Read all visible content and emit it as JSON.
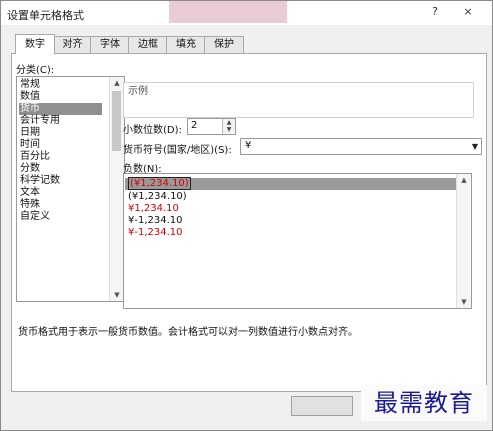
{
  "window": {
    "title": "设置单元格格式",
    "help": "?",
    "close": "×"
  },
  "tabs": [
    {
      "label": "数字"
    },
    {
      "label": "对齐"
    },
    {
      "label": "字体"
    },
    {
      "label": "边框"
    },
    {
      "label": "填充"
    },
    {
      "label": "保护"
    }
  ],
  "active_tab": "数字",
  "category": {
    "label": "分类(C):",
    "items": [
      "常规",
      "数值",
      "货币",
      "会计专用",
      "日期",
      "时间",
      "百分比",
      "分数",
      "科学记数",
      "文本",
      "特殊",
      "自定义"
    ],
    "selected": "货币"
  },
  "sample": {
    "label": "示例"
  },
  "decimal_places": {
    "label": "小数位数(D):",
    "value": "2"
  },
  "currency_symbol": {
    "label": "货币符号(国家/地区)(S):",
    "value": "¥"
  },
  "negative_numbers": {
    "label": "负数(N):",
    "items": [
      {
        "text": "(¥1,234.10)",
        "color": "#d40000"
      },
      {
        "text": "(¥1,234.10)",
        "color": "#111111"
      },
      {
        "text": "¥1,234.10",
        "color": "#d40000"
      },
      {
        "text": "¥-1,234.10",
        "color": "#111111"
      },
      {
        "text": "¥-1,234.10",
        "color": "#d40000"
      }
    ],
    "selected_index": 0
  },
  "description": "货币格式用于表示一般货币数值。会计格式可以对一列数值进行小数点对齐。",
  "watermark": "最需教育",
  "colors": {
    "negative_red": "#d40000",
    "watermark_blue": "#1a1a9a"
  }
}
